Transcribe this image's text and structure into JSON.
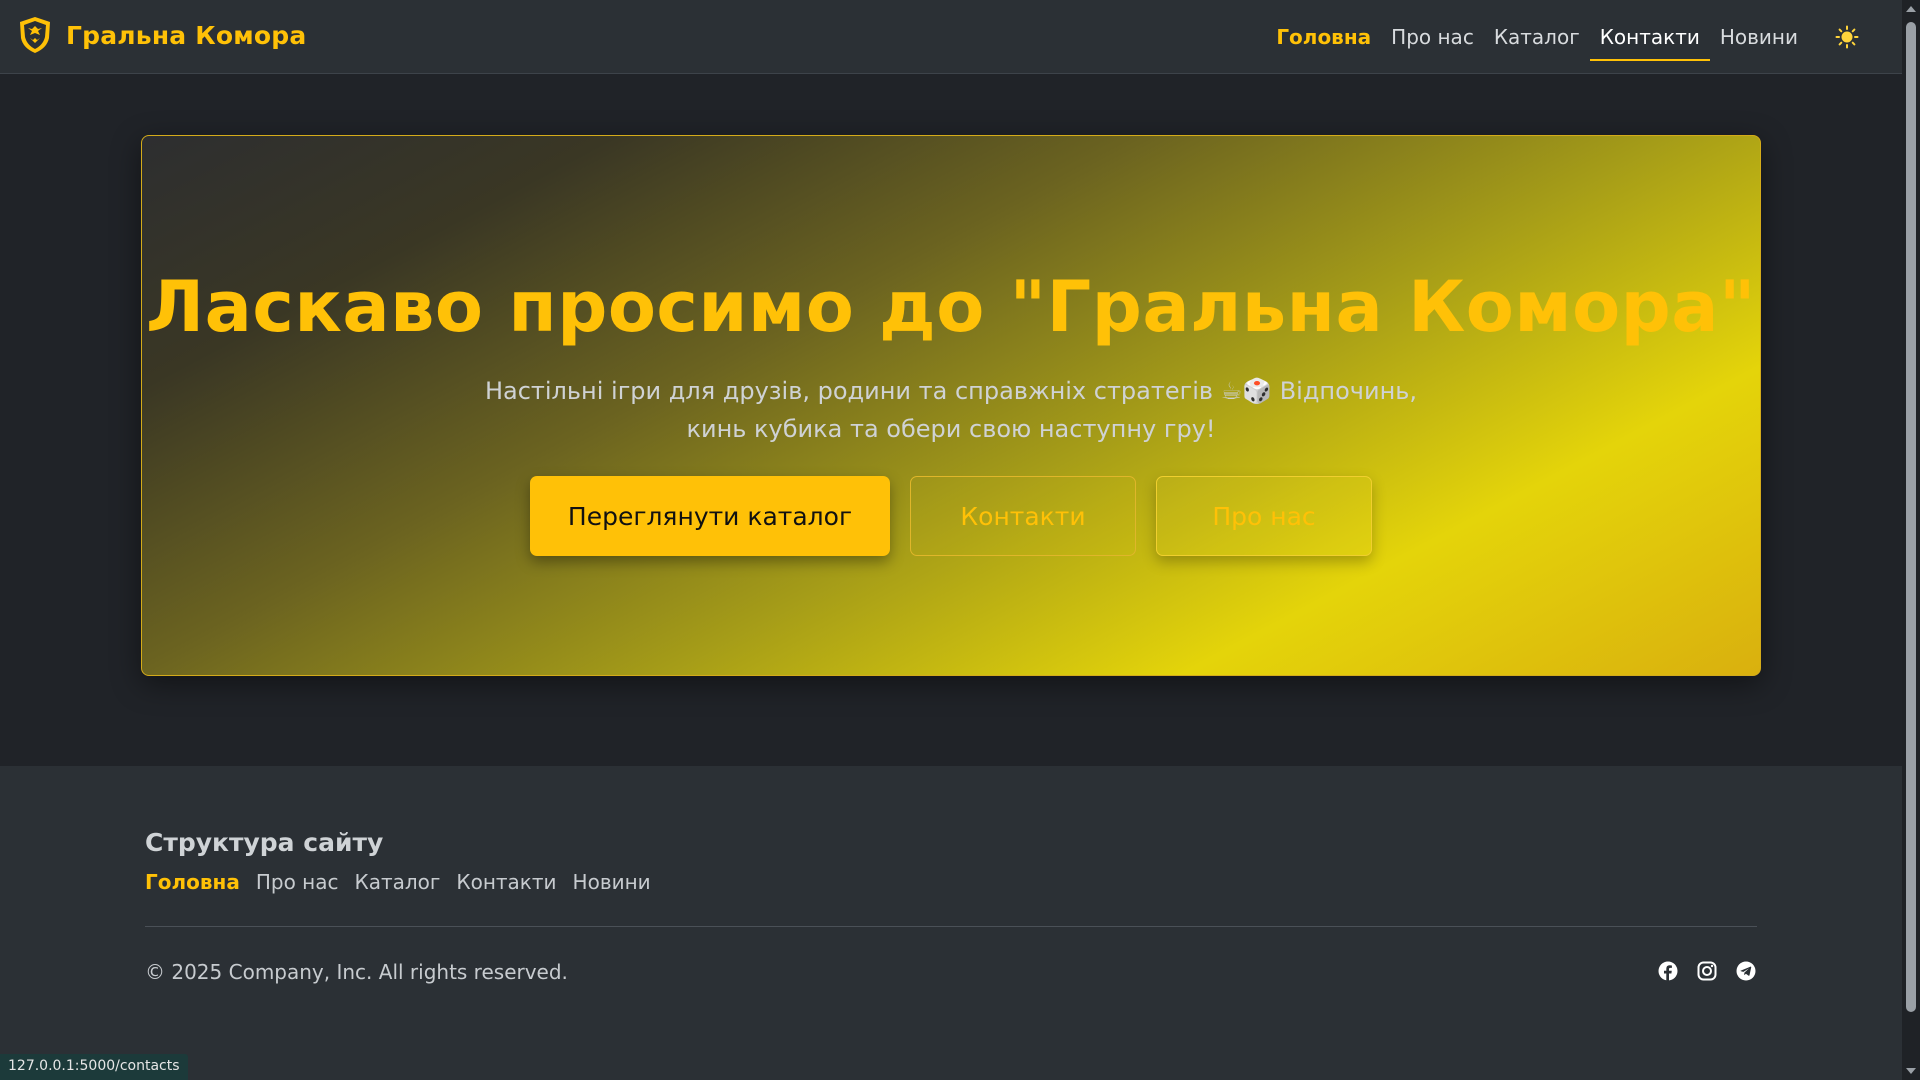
{
  "brand": {
    "name": "Гральна Комора",
    "icon": "tiger-shield-icon"
  },
  "nav": {
    "items": [
      {
        "label": "Головна",
        "state": "active"
      },
      {
        "label": "Про нас",
        "state": "normal"
      },
      {
        "label": "Каталог",
        "state": "normal"
      },
      {
        "label": "Контакти",
        "state": "hovered"
      },
      {
        "label": "Новини",
        "state": "normal"
      }
    ],
    "theme_toggle_icon": "sun-icon"
  },
  "hero": {
    "title": "Ласкаво просимо до \"Гральна Комора\"",
    "subtitle": "Настільні ігри для друзів, родини та справжніх стратегів ☕🎲 Відпочинь, кинь кубика та обери свою наступну гру!",
    "buttons": {
      "catalog": "Переглянути каталог",
      "contacts": "Контакти",
      "about": "Про нас"
    }
  },
  "footer": {
    "title": "Структура сайту",
    "links": [
      "Головна",
      "Про нас",
      "Каталог",
      "Контакти",
      "Новини"
    ],
    "copyright": "© 2025 Company, Inc. All rights reserved.",
    "socials": [
      "facebook-icon",
      "instagram-icon",
      "telegram-icon"
    ]
  },
  "status_bar": {
    "url": "127.0.0.1:5000/contacts"
  },
  "colors": {
    "accent": "#ffc107",
    "navbar_bg": "#2b3035",
    "page_bg": "#202328"
  }
}
